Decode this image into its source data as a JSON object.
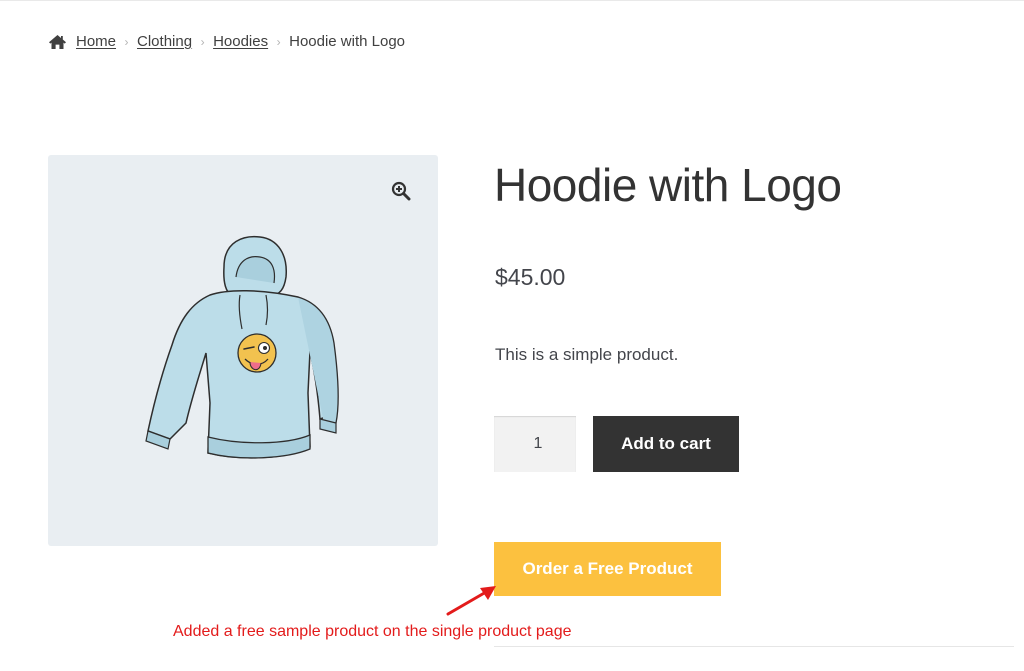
{
  "breadcrumb": {
    "icon": "home-icon",
    "items": [
      {
        "label": "Home"
      },
      {
        "label": "Clothing"
      },
      {
        "label": "Hoodies"
      }
    ],
    "current": "Hoodie with Logo",
    "separator": "›"
  },
  "gallery": {
    "zoom_icon": "magnifier-plus-icon",
    "image_alt": "hoodie-with-logo-illustration"
  },
  "product": {
    "title": "Hoodie with Logo",
    "price": "$45.00",
    "short_description": "This is a simple product.",
    "quantity": "1",
    "add_to_cart_label": "Add to cart",
    "free_product_label": "Order a Free Product"
  },
  "annotation": {
    "text": "Added a free sample product on the single product page",
    "color": "#e31b1b",
    "icon": "arrow-icon"
  },
  "colors": {
    "add_to_cart_bg": "#333333",
    "free_product_bg": "#fcc13f",
    "gallery_bg": "#e9eef2"
  }
}
